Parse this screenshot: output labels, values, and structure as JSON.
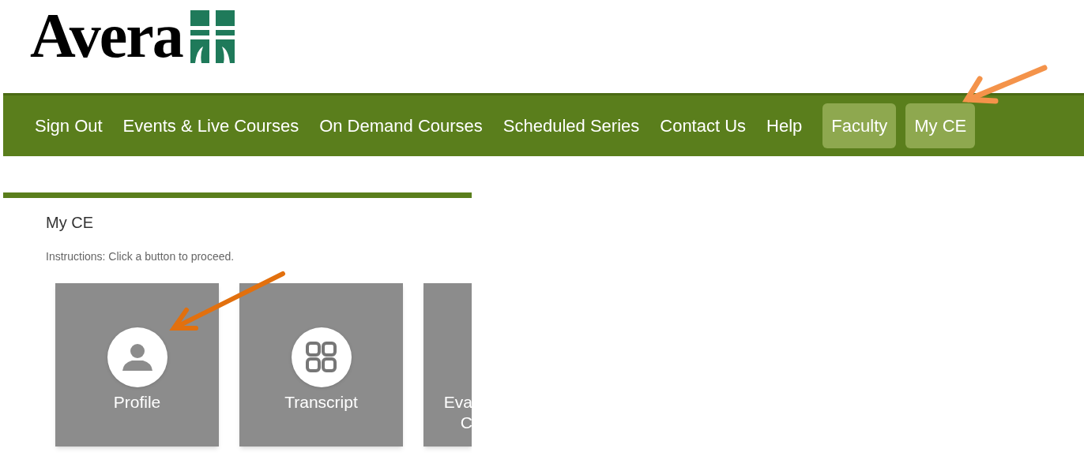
{
  "logo": {
    "text": "Avera"
  },
  "nav": [
    {
      "label": "Sign Out",
      "highlighted": false
    },
    {
      "label": "Events & Live Courses",
      "highlighted": false
    },
    {
      "label": "On Demand Courses",
      "highlighted": false
    },
    {
      "label": "Scheduled Series",
      "highlighted": false
    },
    {
      "label": "Contact Us",
      "highlighted": false
    },
    {
      "label": "Help",
      "highlighted": false
    },
    {
      "label": "Faculty",
      "highlighted": true
    },
    {
      "label": "My CE",
      "highlighted": true
    }
  ],
  "panel": {
    "title": "My CE",
    "instructions": "Instructions: Click a button to proceed.",
    "tiles": [
      {
        "kind": "profile",
        "lines": [
          "Profile"
        ]
      },
      {
        "kind": "transcript",
        "lines": [
          "Transcript"
        ]
      },
      {
        "kind": "clipped",
        "lines": [
          "Eva",
          "C"
        ]
      }
    ]
  }
}
